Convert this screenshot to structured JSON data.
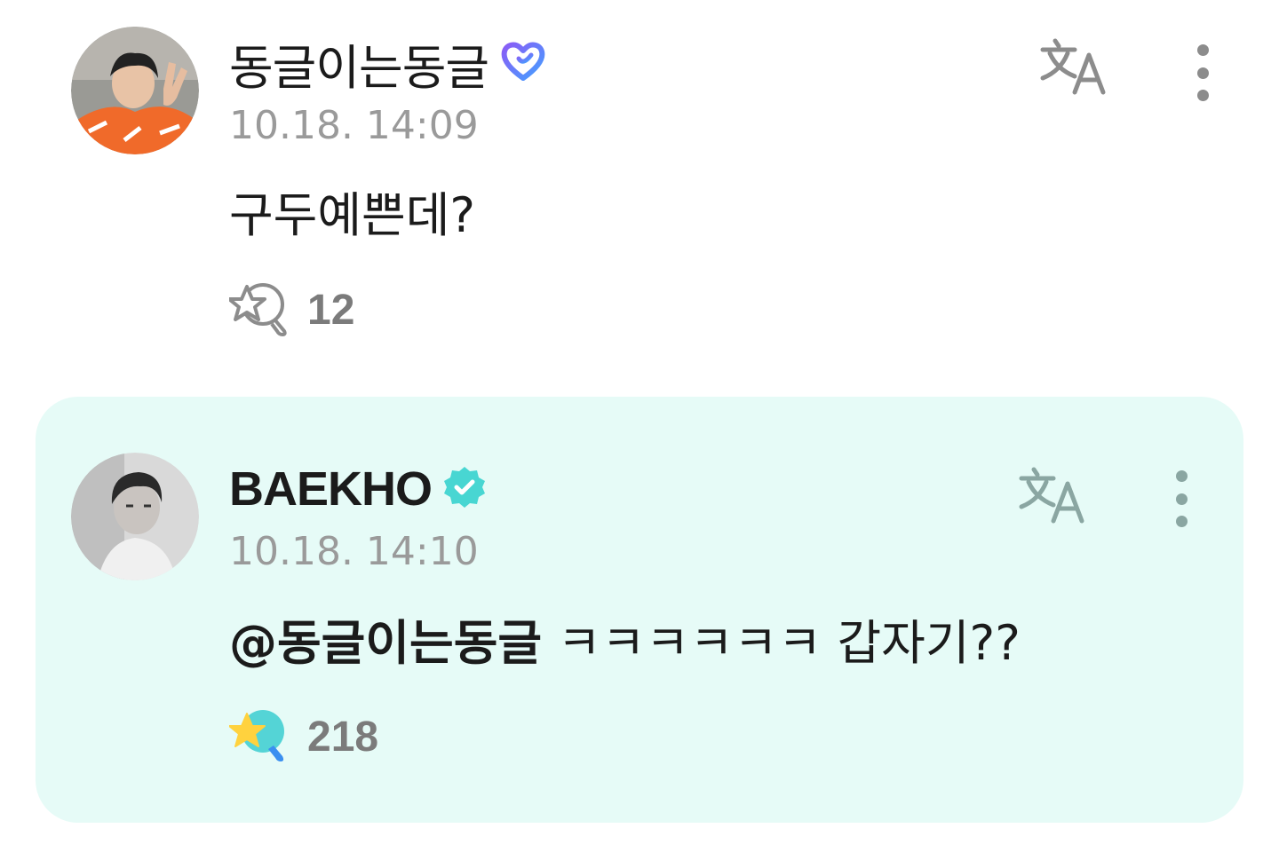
{
  "comments": [
    {
      "author": "동글이는동글",
      "timestamp": "10.18. 14:09",
      "text": "구두예쁜데?",
      "reaction_count": "12",
      "badge_icon": "heart-badge-icon",
      "reaction_icon": "star-magnifier-outline-icon",
      "translate_icon": "translate-icon",
      "more_icon": "more-vertical-icon"
    }
  ],
  "reply": {
    "author": "BAEKHO",
    "timestamp": "10.18. 14:10",
    "mention": "@동글이는동글",
    "text": " ㅋㅋㅋㅋㅋㅋ 갑자기??",
    "reaction_count": "218",
    "badge_icon": "verified-badge-icon",
    "reaction_icon": "star-magnifier-filled-icon",
    "translate_icon": "translate-icon",
    "more_icon": "more-vertical-icon"
  },
  "colors": {
    "reply_background": "#e6fbf7",
    "verified": "#48d6d2",
    "heart_badge_gradient": [
      "#8a5cf6",
      "#44a0ff"
    ],
    "timestamp": "#9a9a9a",
    "icon_gray": "#8c8c8c"
  }
}
